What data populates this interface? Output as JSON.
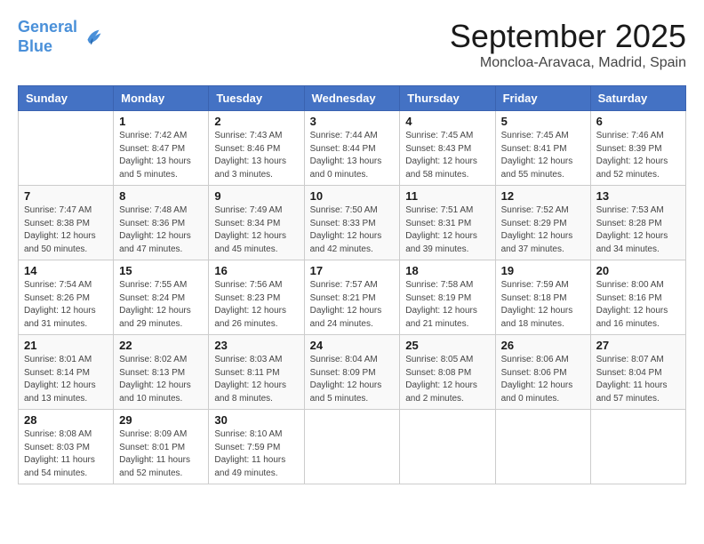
{
  "header": {
    "logo_line1": "General",
    "logo_line2": "Blue",
    "month": "September 2025",
    "location": "Moncloa-Aravaca, Madrid, Spain"
  },
  "days_of_week": [
    "Sunday",
    "Monday",
    "Tuesday",
    "Wednesday",
    "Thursday",
    "Friday",
    "Saturday"
  ],
  "weeks": [
    [
      {
        "day": "",
        "info": ""
      },
      {
        "day": "1",
        "info": "Sunrise: 7:42 AM\nSunset: 8:47 PM\nDaylight: 13 hours\nand 5 minutes."
      },
      {
        "day": "2",
        "info": "Sunrise: 7:43 AM\nSunset: 8:46 PM\nDaylight: 13 hours\nand 3 minutes."
      },
      {
        "day": "3",
        "info": "Sunrise: 7:44 AM\nSunset: 8:44 PM\nDaylight: 13 hours\nand 0 minutes."
      },
      {
        "day": "4",
        "info": "Sunrise: 7:45 AM\nSunset: 8:43 PM\nDaylight: 12 hours\nand 58 minutes."
      },
      {
        "day": "5",
        "info": "Sunrise: 7:45 AM\nSunset: 8:41 PM\nDaylight: 12 hours\nand 55 minutes."
      },
      {
        "day": "6",
        "info": "Sunrise: 7:46 AM\nSunset: 8:39 PM\nDaylight: 12 hours\nand 52 minutes."
      }
    ],
    [
      {
        "day": "7",
        "info": "Sunrise: 7:47 AM\nSunset: 8:38 PM\nDaylight: 12 hours\nand 50 minutes."
      },
      {
        "day": "8",
        "info": "Sunrise: 7:48 AM\nSunset: 8:36 PM\nDaylight: 12 hours\nand 47 minutes."
      },
      {
        "day": "9",
        "info": "Sunrise: 7:49 AM\nSunset: 8:34 PM\nDaylight: 12 hours\nand 45 minutes."
      },
      {
        "day": "10",
        "info": "Sunrise: 7:50 AM\nSunset: 8:33 PM\nDaylight: 12 hours\nand 42 minutes."
      },
      {
        "day": "11",
        "info": "Sunrise: 7:51 AM\nSunset: 8:31 PM\nDaylight: 12 hours\nand 39 minutes."
      },
      {
        "day": "12",
        "info": "Sunrise: 7:52 AM\nSunset: 8:29 PM\nDaylight: 12 hours\nand 37 minutes."
      },
      {
        "day": "13",
        "info": "Sunrise: 7:53 AM\nSunset: 8:28 PM\nDaylight: 12 hours\nand 34 minutes."
      }
    ],
    [
      {
        "day": "14",
        "info": "Sunrise: 7:54 AM\nSunset: 8:26 PM\nDaylight: 12 hours\nand 31 minutes."
      },
      {
        "day": "15",
        "info": "Sunrise: 7:55 AM\nSunset: 8:24 PM\nDaylight: 12 hours\nand 29 minutes."
      },
      {
        "day": "16",
        "info": "Sunrise: 7:56 AM\nSunset: 8:23 PM\nDaylight: 12 hours\nand 26 minutes."
      },
      {
        "day": "17",
        "info": "Sunrise: 7:57 AM\nSunset: 8:21 PM\nDaylight: 12 hours\nand 24 minutes."
      },
      {
        "day": "18",
        "info": "Sunrise: 7:58 AM\nSunset: 8:19 PM\nDaylight: 12 hours\nand 21 minutes."
      },
      {
        "day": "19",
        "info": "Sunrise: 7:59 AM\nSunset: 8:18 PM\nDaylight: 12 hours\nand 18 minutes."
      },
      {
        "day": "20",
        "info": "Sunrise: 8:00 AM\nSunset: 8:16 PM\nDaylight: 12 hours\nand 16 minutes."
      }
    ],
    [
      {
        "day": "21",
        "info": "Sunrise: 8:01 AM\nSunset: 8:14 PM\nDaylight: 12 hours\nand 13 minutes."
      },
      {
        "day": "22",
        "info": "Sunrise: 8:02 AM\nSunset: 8:13 PM\nDaylight: 12 hours\nand 10 minutes."
      },
      {
        "day": "23",
        "info": "Sunrise: 8:03 AM\nSunset: 8:11 PM\nDaylight: 12 hours\nand 8 minutes."
      },
      {
        "day": "24",
        "info": "Sunrise: 8:04 AM\nSunset: 8:09 PM\nDaylight: 12 hours\nand 5 minutes."
      },
      {
        "day": "25",
        "info": "Sunrise: 8:05 AM\nSunset: 8:08 PM\nDaylight: 12 hours\nand 2 minutes."
      },
      {
        "day": "26",
        "info": "Sunrise: 8:06 AM\nSunset: 8:06 PM\nDaylight: 12 hours\nand 0 minutes."
      },
      {
        "day": "27",
        "info": "Sunrise: 8:07 AM\nSunset: 8:04 PM\nDaylight: 11 hours\nand 57 minutes."
      }
    ],
    [
      {
        "day": "28",
        "info": "Sunrise: 8:08 AM\nSunset: 8:03 PM\nDaylight: 11 hours\nand 54 minutes."
      },
      {
        "day": "29",
        "info": "Sunrise: 8:09 AM\nSunset: 8:01 PM\nDaylight: 11 hours\nand 52 minutes."
      },
      {
        "day": "30",
        "info": "Sunrise: 8:10 AM\nSunset: 7:59 PM\nDaylight: 11 hours\nand 49 minutes."
      },
      {
        "day": "",
        "info": ""
      },
      {
        "day": "",
        "info": ""
      },
      {
        "day": "",
        "info": ""
      },
      {
        "day": "",
        "info": ""
      }
    ]
  ]
}
